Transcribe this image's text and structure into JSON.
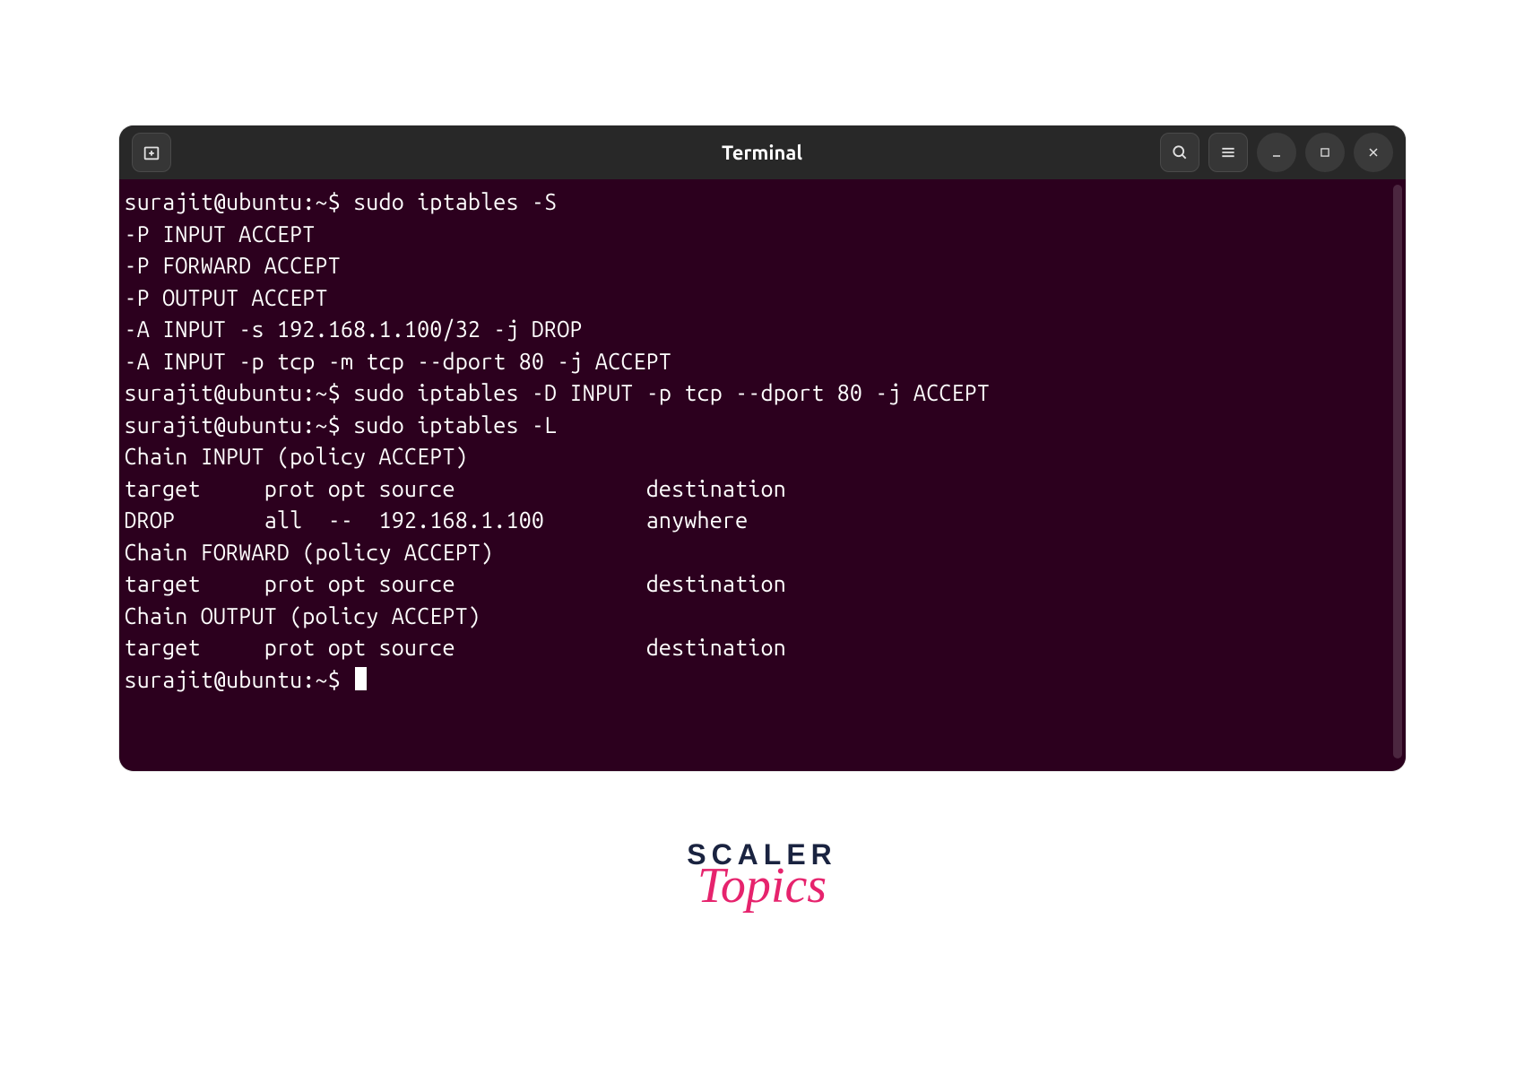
{
  "titlebar": {
    "title": "Terminal"
  },
  "terminal": {
    "lines": [
      "surajit@ubuntu:~$ sudo iptables -S",
      "-P INPUT ACCEPT",
      "-P FORWARD ACCEPT",
      "-P OUTPUT ACCEPT",
      "-A INPUT -s 192.168.1.100/32 -j DROP",
      "-A INPUT -p tcp -m tcp --dport 80 -j ACCEPT",
      "surajit@ubuntu:~$ sudo iptables -D INPUT -p tcp --dport 80 -j ACCEPT",
      "surajit@ubuntu:~$ sudo iptables -L",
      "Chain INPUT (policy ACCEPT)",
      "target     prot opt source               destination",
      "DROP       all  --  192.168.1.100        anywhere",
      "",
      "Chain FORWARD (policy ACCEPT)",
      "target     prot opt source               destination",
      "",
      "Chain OUTPUT (policy ACCEPT)",
      "target     prot opt source               destination",
      "surajit@ubuntu:~$ "
    ]
  },
  "logo": {
    "line1": "SCALER",
    "line2": "Topics"
  }
}
